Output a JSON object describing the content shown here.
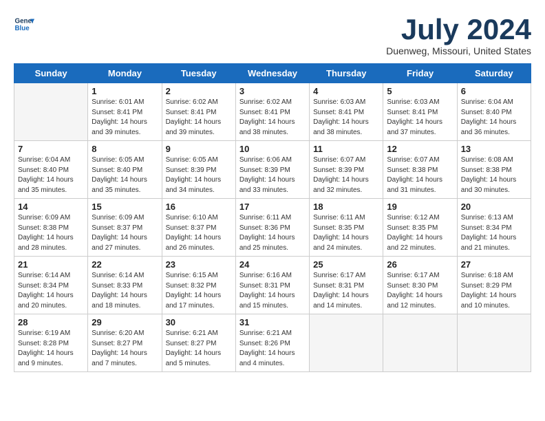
{
  "header": {
    "logo_line1": "General",
    "logo_line2": "Blue",
    "month_title": "July 2024",
    "location": "Duenweg, Missouri, United States"
  },
  "days_of_week": [
    "Sunday",
    "Monday",
    "Tuesday",
    "Wednesday",
    "Thursday",
    "Friday",
    "Saturday"
  ],
  "weeks": [
    [
      {
        "day": "",
        "info": ""
      },
      {
        "day": "1",
        "info": "Sunrise: 6:01 AM\nSunset: 8:41 PM\nDaylight: 14 hours\nand 39 minutes."
      },
      {
        "day": "2",
        "info": "Sunrise: 6:02 AM\nSunset: 8:41 PM\nDaylight: 14 hours\nand 39 minutes."
      },
      {
        "day": "3",
        "info": "Sunrise: 6:02 AM\nSunset: 8:41 PM\nDaylight: 14 hours\nand 38 minutes."
      },
      {
        "day": "4",
        "info": "Sunrise: 6:03 AM\nSunset: 8:41 PM\nDaylight: 14 hours\nand 38 minutes."
      },
      {
        "day": "5",
        "info": "Sunrise: 6:03 AM\nSunset: 8:41 PM\nDaylight: 14 hours\nand 37 minutes."
      },
      {
        "day": "6",
        "info": "Sunrise: 6:04 AM\nSunset: 8:40 PM\nDaylight: 14 hours\nand 36 minutes."
      }
    ],
    [
      {
        "day": "7",
        "info": "Sunrise: 6:04 AM\nSunset: 8:40 PM\nDaylight: 14 hours\nand 35 minutes."
      },
      {
        "day": "8",
        "info": "Sunrise: 6:05 AM\nSunset: 8:40 PM\nDaylight: 14 hours\nand 35 minutes."
      },
      {
        "day": "9",
        "info": "Sunrise: 6:05 AM\nSunset: 8:39 PM\nDaylight: 14 hours\nand 34 minutes."
      },
      {
        "day": "10",
        "info": "Sunrise: 6:06 AM\nSunset: 8:39 PM\nDaylight: 14 hours\nand 33 minutes."
      },
      {
        "day": "11",
        "info": "Sunrise: 6:07 AM\nSunset: 8:39 PM\nDaylight: 14 hours\nand 32 minutes."
      },
      {
        "day": "12",
        "info": "Sunrise: 6:07 AM\nSunset: 8:38 PM\nDaylight: 14 hours\nand 31 minutes."
      },
      {
        "day": "13",
        "info": "Sunrise: 6:08 AM\nSunset: 8:38 PM\nDaylight: 14 hours\nand 30 minutes."
      }
    ],
    [
      {
        "day": "14",
        "info": "Sunrise: 6:09 AM\nSunset: 8:38 PM\nDaylight: 14 hours\nand 28 minutes."
      },
      {
        "day": "15",
        "info": "Sunrise: 6:09 AM\nSunset: 8:37 PM\nDaylight: 14 hours\nand 27 minutes."
      },
      {
        "day": "16",
        "info": "Sunrise: 6:10 AM\nSunset: 8:37 PM\nDaylight: 14 hours\nand 26 minutes."
      },
      {
        "day": "17",
        "info": "Sunrise: 6:11 AM\nSunset: 8:36 PM\nDaylight: 14 hours\nand 25 minutes."
      },
      {
        "day": "18",
        "info": "Sunrise: 6:11 AM\nSunset: 8:35 PM\nDaylight: 14 hours\nand 24 minutes."
      },
      {
        "day": "19",
        "info": "Sunrise: 6:12 AM\nSunset: 8:35 PM\nDaylight: 14 hours\nand 22 minutes."
      },
      {
        "day": "20",
        "info": "Sunrise: 6:13 AM\nSunset: 8:34 PM\nDaylight: 14 hours\nand 21 minutes."
      }
    ],
    [
      {
        "day": "21",
        "info": "Sunrise: 6:14 AM\nSunset: 8:34 PM\nDaylight: 14 hours\nand 20 minutes."
      },
      {
        "day": "22",
        "info": "Sunrise: 6:14 AM\nSunset: 8:33 PM\nDaylight: 14 hours\nand 18 minutes."
      },
      {
        "day": "23",
        "info": "Sunrise: 6:15 AM\nSunset: 8:32 PM\nDaylight: 14 hours\nand 17 minutes."
      },
      {
        "day": "24",
        "info": "Sunrise: 6:16 AM\nSunset: 8:31 PM\nDaylight: 14 hours\nand 15 minutes."
      },
      {
        "day": "25",
        "info": "Sunrise: 6:17 AM\nSunset: 8:31 PM\nDaylight: 14 hours\nand 14 minutes."
      },
      {
        "day": "26",
        "info": "Sunrise: 6:17 AM\nSunset: 8:30 PM\nDaylight: 14 hours\nand 12 minutes."
      },
      {
        "day": "27",
        "info": "Sunrise: 6:18 AM\nSunset: 8:29 PM\nDaylight: 14 hours\nand 10 minutes."
      }
    ],
    [
      {
        "day": "28",
        "info": "Sunrise: 6:19 AM\nSunset: 8:28 PM\nDaylight: 14 hours\nand 9 minutes."
      },
      {
        "day": "29",
        "info": "Sunrise: 6:20 AM\nSunset: 8:27 PM\nDaylight: 14 hours\nand 7 minutes."
      },
      {
        "day": "30",
        "info": "Sunrise: 6:21 AM\nSunset: 8:27 PM\nDaylight: 14 hours\nand 5 minutes."
      },
      {
        "day": "31",
        "info": "Sunrise: 6:21 AM\nSunset: 8:26 PM\nDaylight: 14 hours\nand 4 minutes."
      },
      {
        "day": "",
        "info": ""
      },
      {
        "day": "",
        "info": ""
      },
      {
        "day": "",
        "info": ""
      }
    ]
  ]
}
